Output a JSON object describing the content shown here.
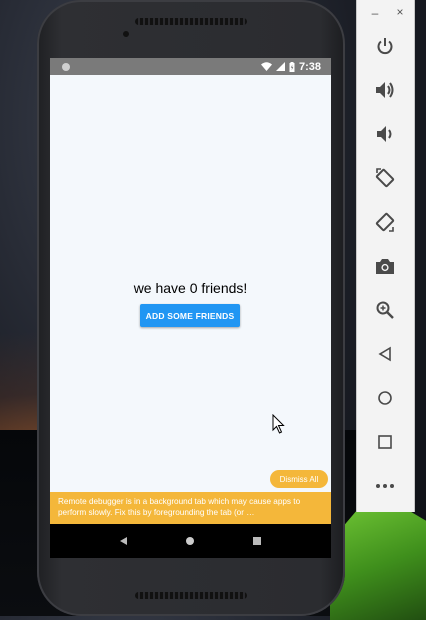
{
  "statusbar": {
    "time": "7:38"
  },
  "app": {
    "friends_text": "we have 0 friends!",
    "add_button_label": "ADD SOME FRIENDS"
  },
  "debugger": {
    "dismiss_label": "Dismiss All",
    "warning_text": "Remote debugger is in a background tab which may cause apps to perform slowly. Fix this by foregrounding the tab (or …"
  },
  "emulator_sidebar": {
    "minimize_symbol": "–",
    "close_symbol": "×",
    "buttons": [
      {
        "icon": "power-icon"
      },
      {
        "icon": "volume-up-icon"
      },
      {
        "icon": "volume-down-icon"
      },
      {
        "icon": "rotate-left-icon"
      },
      {
        "icon": "rotate-right-icon"
      },
      {
        "icon": "camera-icon"
      },
      {
        "icon": "zoom-icon"
      },
      {
        "icon": "back-icon"
      },
      {
        "icon": "home-icon"
      },
      {
        "icon": "overview-icon"
      },
      {
        "icon": "more-icon"
      }
    ]
  },
  "colors": {
    "accent_button": "#2196f3",
    "warning_banner": "#f4b73a",
    "screen_bg": "#f4f8fc",
    "status_bar": "#7a7a7a"
  }
}
